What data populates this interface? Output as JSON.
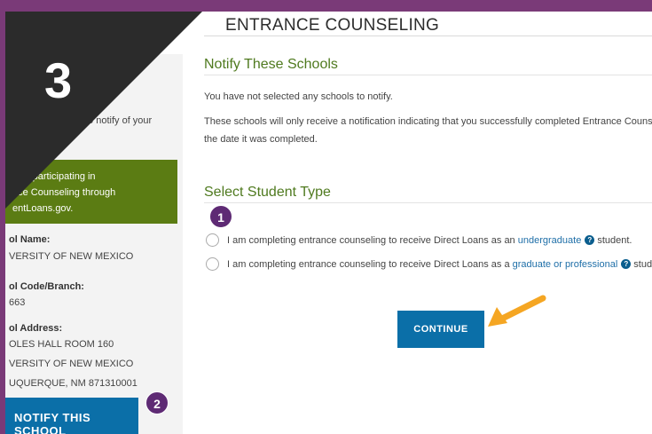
{
  "header": {
    "title": "ENTRANCE COUNSELING"
  },
  "step": {
    "number": "3"
  },
  "sidebar": {
    "intro_line1": "to notify of your",
    "participating_line1": "ol is participating in",
    "participating_line2": "nce Counseling through",
    "participating_line3": "entLoans.gov.",
    "school_name_label": "ol Name:",
    "school_name_value": "VERSITY OF NEW MEXICO",
    "school_code_label": "ol Code/Branch:",
    "school_code_value": "663",
    "school_address_label": "ol Address:",
    "address_line1": "OLES HALL ROOM 160",
    "address_line2": "VERSITY OF NEW MEXICO",
    "address_line3": "UQUERQUE, NM 871310001",
    "notify_button": "NOTIFY THIS SCHOOL"
  },
  "notify_section": {
    "heading": "Notify These Schools",
    "no_selection_text": "You have not selected any schools to notify.",
    "info_line1": "These schools will only receive a notification indicating that you successfully completed Entrance Counseling,",
    "info_line2": "the date it was completed."
  },
  "student_type": {
    "heading": "Select Student Type",
    "option1_prefix": "I am completing entrance counseling to receive Direct Loans as an",
    "option1_link": "undergraduate",
    "option1_suffix": "student.",
    "option2_prefix": "I am completing entrance counseling to receive Direct Loans as a",
    "option2_link": "graduate or professional",
    "option2_suffix": "student.",
    "help_glyph": "?"
  },
  "continue_button": "CONTINUE",
  "annotations": {
    "badge1": "1",
    "badge2": "2"
  },
  "icons": {
    "help": "question-circle-icon",
    "radio": "radio-button-icon",
    "arrow": "pointer-arrow-icon"
  },
  "colors": {
    "accent_purple": "#7a3a78",
    "primary_blue": "#0b6fa8",
    "heading_green": "#4f7a1f",
    "banner_green": "#5b7c13",
    "arrow_orange": "#f5a623",
    "corner_dark": "#2b2b2b"
  }
}
